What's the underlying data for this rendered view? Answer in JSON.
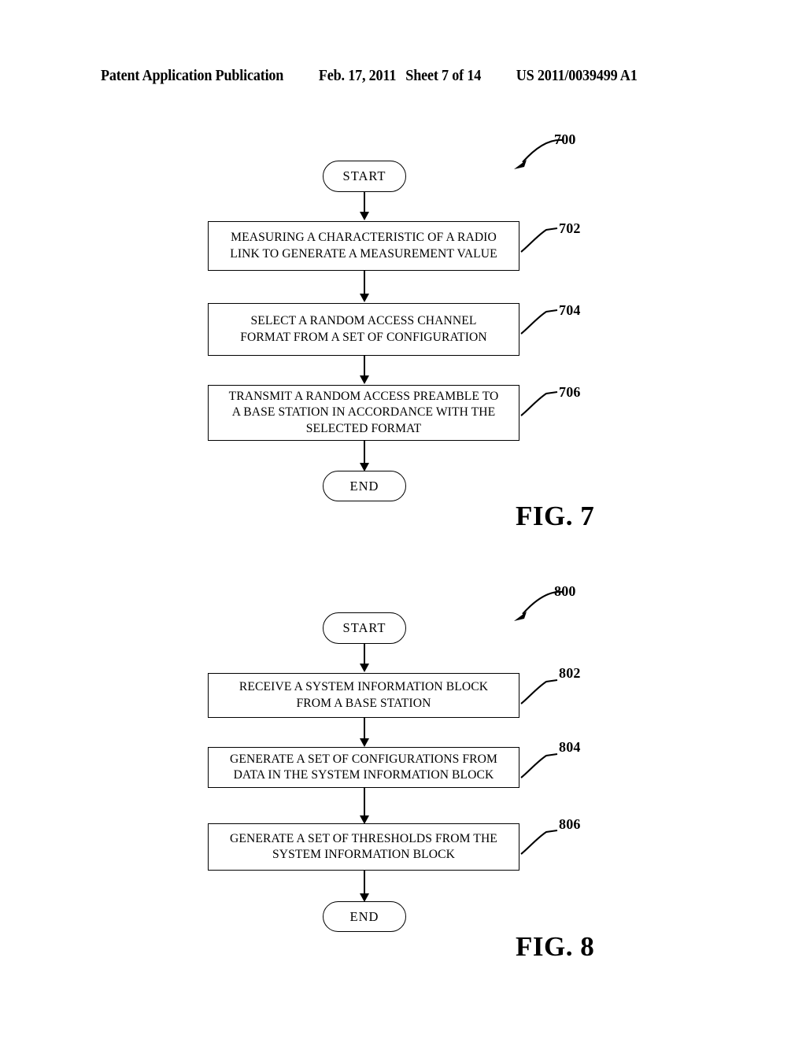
{
  "header": {
    "publication": "Patent Application Publication",
    "date": "Feb. 17, 2011",
    "sheet": "Sheet 7 of 14",
    "patent_number": "US 2011/0039499 A1"
  },
  "figures": [
    {
      "id": "fig7",
      "caption": "FIG. 7",
      "diagram_ref": "700",
      "nodes": [
        {
          "key": "start",
          "type": "terminator",
          "text": "START"
        },
        {
          "key": "step702",
          "type": "process",
          "ref": "702",
          "lines": [
            "MEASURING A CHARACTERISTIC OF A RADIO",
            "LINK TO GENERATE A MEASUREMENT VALUE"
          ]
        },
        {
          "key": "step704",
          "type": "process",
          "ref": "704",
          "lines": [
            "SELECT A RANDOM ACCESS CHANNEL",
            "FORMAT FROM A SET OF CONFIGURATION"
          ]
        },
        {
          "key": "step706",
          "type": "process",
          "ref": "706",
          "lines": [
            "TRANSMIT A RANDOM ACCESS PREAMBLE TO",
            "A BASE STATION IN ACCORDANCE WITH THE",
            "SELECTED FORMAT"
          ]
        },
        {
          "key": "end",
          "type": "terminator",
          "text": "END"
        }
      ]
    },
    {
      "id": "fig8",
      "caption": "FIG. 8",
      "diagram_ref": "800",
      "nodes": [
        {
          "key": "start",
          "type": "terminator",
          "text": "START"
        },
        {
          "key": "step802",
          "type": "process",
          "ref": "802",
          "lines": [
            "RECEIVE A SYSTEM INFORMATION BLOCK",
            "FROM A BASE STATION"
          ]
        },
        {
          "key": "step804",
          "type": "process",
          "ref": "804",
          "lines": [
            "GENERATE A SET OF CONFIGURATIONS FROM",
            "DATA IN THE SYSTEM INFORMATION BLOCK"
          ]
        },
        {
          "key": "step806",
          "type": "process",
          "ref": "806",
          "lines": [
            "GENERATE A SET OF THRESHOLDS FROM THE",
            "SYSTEM INFORMATION BLOCK"
          ]
        },
        {
          "key": "end",
          "type": "terminator",
          "text": "END"
        }
      ]
    }
  ]
}
